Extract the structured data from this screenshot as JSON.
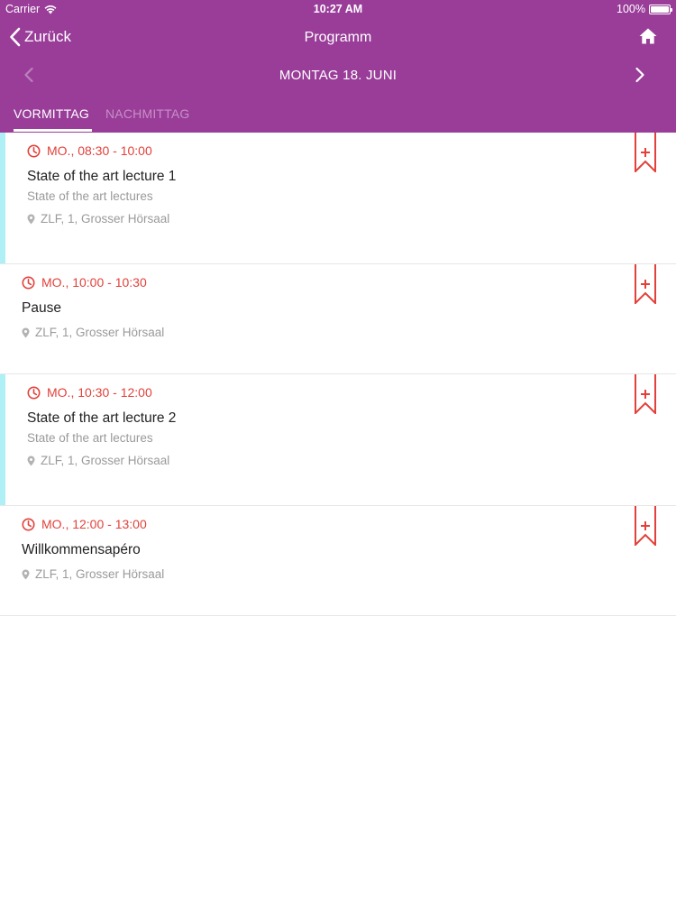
{
  "status_bar": {
    "carrier": "Carrier",
    "time": "10:27 AM",
    "battery": "100%"
  },
  "nav": {
    "back_label": "Zurück",
    "title": "Programm",
    "home_icon": "home-icon"
  },
  "day_nav": {
    "label": "MONTAG 18. JUNI"
  },
  "tabs": [
    {
      "label": "VORMITTAG",
      "active": true
    },
    {
      "label": "NACHMITTAG",
      "active": false
    }
  ],
  "colors": {
    "header": "#993d99",
    "accent_time": "#e2413a",
    "stripe": "#aef0f5",
    "muted": "#9a9a9a"
  },
  "sessions": [
    {
      "time": "MO., 08:30 - 10:00",
      "title": "State of the art lecture 1",
      "subtitle": "State of the art lectures",
      "location": "ZLF, 1, Grosser Hörsaal",
      "highlighted": true
    },
    {
      "time": "MO., 10:00 - 10:30",
      "title": "Pause",
      "subtitle": "",
      "location": "ZLF, 1, Grosser Hörsaal",
      "highlighted": false
    },
    {
      "time": "MO., 10:30 - 12:00",
      "title": "State of the art lecture 2",
      "subtitle": "State of the art lectures",
      "location": "ZLF, 1, Grosser Hörsaal",
      "highlighted": true
    },
    {
      "time": "MO., 12:00 - 13:00",
      "title": "Willkommensapéro",
      "subtitle": "",
      "location": "ZLF, 1, Grosser Hörsaal",
      "highlighted": false
    }
  ]
}
